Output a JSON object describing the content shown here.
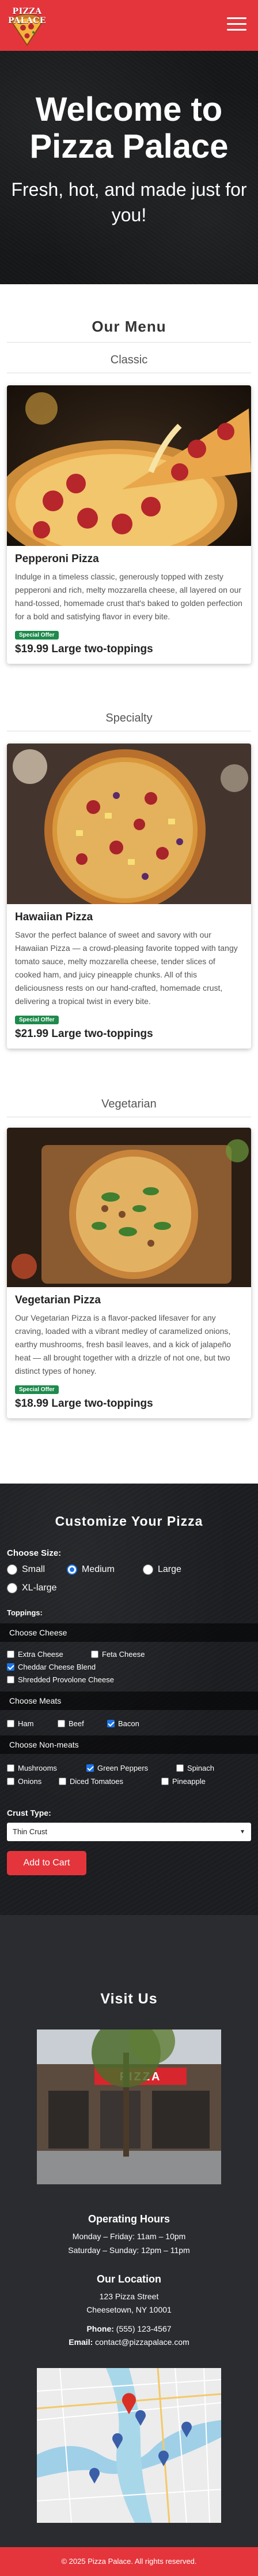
{
  "header": {
    "logo_text": "PIZZA PALACE",
    "menu_icon": "hamburger-menu-icon",
    "brand_color": "#e4353c"
  },
  "hero": {
    "title": "Welcome to Pizza Palace",
    "subtitle": "Fresh, hot, and made just for you!"
  },
  "menu": {
    "heading": "Our Menu",
    "categories": [
      {
        "name": "Classic",
        "item": {
          "name": "Pepperoni Pizza",
          "description": "Indulge in a timeless classic, generously topped with zesty pepperoni and rich, melty mozzarella cheese, all layered on our hand-tossed, homemade crust that's baked to golden perfection for a bold and satisfying flavor in every bite.",
          "badge": "Special Offer",
          "price": "$19.99 Large two-toppings"
        }
      },
      {
        "name": "Specialty",
        "item": {
          "name": "Hawaiian Pizza",
          "description": "Savor the perfect balance of sweet and savory with our Hawaiian Pizza — a crowd-pleasing favorite topped with tangy tomato sauce, melty mozzarella cheese, tender slices of cooked ham, and juicy pineapple chunks. All of this deliciousness rests on our hand-crafted, homemade crust, delivering a tropical twist in every bite.",
          "badge": "Special Offer",
          "price": "$21.99 Large two-toppings"
        }
      },
      {
        "name": "Vegetarian",
        "item": {
          "name": "Vegetarian Pizza",
          "description": "Our Vegetarian Pizza is a flavor-packed lifesaver for any craving, loaded with a vibrant medley of caramelized onions, earthy mushrooms, fresh basil leaves, and a kick of jalapeño heat — all brought together with a drizzle of not one, but two distinct types of honey.",
          "badge": "Special Offer",
          "price": "$18.99 Large two-toppings"
        }
      }
    ]
  },
  "customize": {
    "heading": "Customize Your Pizza",
    "size_label": "Choose Size:",
    "sizes": [
      {
        "label": "Small",
        "selected": false
      },
      {
        "label": "Medium",
        "selected": true
      },
      {
        "label": "Large",
        "selected": false
      },
      {
        "label": "XL-large",
        "selected": false
      }
    ],
    "toppings_label": "Toppings:",
    "cheese_band": "Choose Cheese",
    "cheeses": [
      {
        "label": "Extra Cheese",
        "checked": false
      },
      {
        "label": "Feta Cheese",
        "checked": false
      },
      {
        "label": "Cheddar Cheese Blend",
        "checked": true
      },
      {
        "label": "Shredded Provolone Cheese",
        "checked": false
      }
    ],
    "meats_band": "Choose Meats",
    "meats": [
      {
        "label": "Ham",
        "checked": false
      },
      {
        "label": "Beef",
        "checked": false
      },
      {
        "label": "Bacon",
        "checked": true
      }
    ],
    "nonmeats_band": "Choose Non-meats",
    "nonmeats": [
      {
        "label": "Mushrooms",
        "checked": false
      },
      {
        "label": "Green Peppers",
        "checked": true
      },
      {
        "label": "Spinach",
        "checked": false
      },
      {
        "label": "Onions",
        "checked": false
      },
      {
        "label": "Diced Tomatoes",
        "checked": false
      },
      {
        "label": "Pineapple",
        "checked": false
      }
    ],
    "crust_label": "Crust Type:",
    "crust_value": "Thin Crust",
    "cart_button": "Add to Cart"
  },
  "visit": {
    "heading": "Visit Us",
    "storefront_sign": "PIZZA",
    "hours_heading": "Operating Hours",
    "hours_weekday": "Monday – Friday: 11am – 10pm",
    "hours_weekend": "Saturday – Sunday: 12pm – 11pm",
    "location_heading": "Our Location",
    "address_line1": "123 Pizza Street",
    "address_line2": "Cheesetown, NY 10001",
    "phone_label": "Phone:",
    "phone": "(555) 123-4567",
    "email_label": "Email:",
    "email": "contact@pizzapalace.com"
  },
  "footer": {
    "text": "© 2025 Pizza Palace. All rights reserved."
  }
}
